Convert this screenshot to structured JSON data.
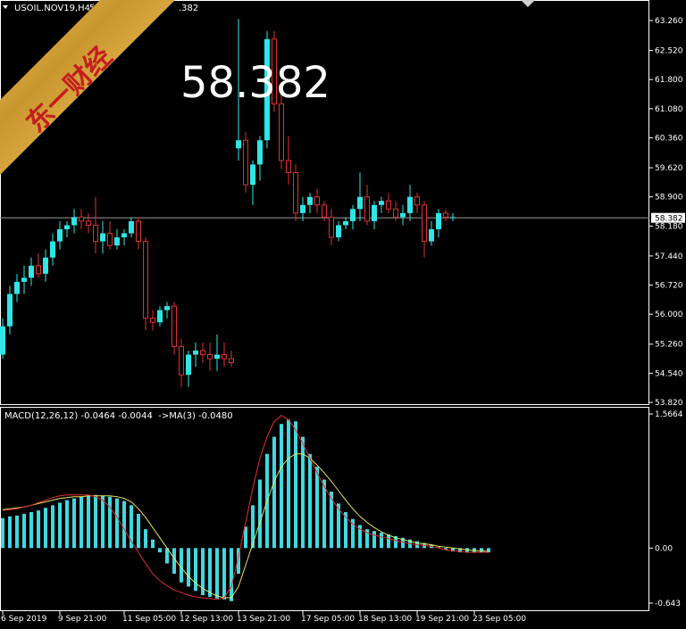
{
  "header": {
    "symbol_label": "USOIL.NOV19,H4",
    "ohlc_label": "58.37",
    "ohlc_tail": ".382"
  },
  "watermark_text": "东一财经",
  "big_price": "58.382",
  "current_price_label": "58.382",
  "colors": {
    "bull": "#2EE6E6",
    "bear": "#E03030",
    "macd_hist": "#40D8E0",
    "signal": "#E6E060",
    "macd_line": "#E03030",
    "grid_text": "#FFFFFF",
    "panel_border": "#FFFFFF"
  },
  "chart_data": [
    {
      "type": "candlestick",
      "ylim": [
        53.82,
        63.26
      ],
      "y_ticks": [
        "63.260",
        "62.520",
        "61.800",
        "61.080",
        "60.360",
        "59.620",
        "58.900",
        "58.180",
        "57.440",
        "56.720",
        "56.000",
        "55.260",
        "54.540",
        "53.820"
      ],
      "y_tick_values": [
        63.26,
        62.52,
        61.8,
        61.08,
        60.36,
        59.62,
        58.9,
        58.18,
        57.44,
        56.72,
        56.0,
        55.26,
        54.54,
        53.82
      ],
      "current_price": 58.382,
      "candles": [
        [
          55.0,
          55.9,
          54.9,
          55.7
        ],
        [
          55.7,
          56.7,
          55.5,
          56.5
        ],
        [
          56.5,
          57.0,
          56.3,
          56.8
        ],
        [
          56.8,
          57.2,
          56.5,
          56.9
        ],
        [
          56.9,
          57.4,
          56.7,
          57.2
        ],
        [
          57.2,
          57.5,
          56.9,
          57.0
        ],
        [
          57.0,
          57.6,
          56.8,
          57.4
        ],
        [
          57.4,
          58.0,
          57.2,
          57.8
        ],
        [
          57.8,
          58.3,
          57.6,
          58.1
        ],
        [
          58.1,
          58.3,
          57.9,
          58.2
        ],
        [
          58.2,
          58.6,
          58.0,
          58.4
        ],
        [
          58.4,
          58.6,
          58.1,
          58.3
        ],
        [
          58.3,
          58.5,
          58.0,
          58.2
        ],
        [
          58.2,
          58.9,
          57.5,
          57.8
        ],
        [
          57.8,
          58.3,
          57.5,
          58.0
        ],
        [
          58.0,
          58.3,
          57.6,
          57.7
        ],
        [
          57.7,
          58.1,
          57.6,
          57.9
        ],
        [
          57.9,
          58.1,
          57.7,
          58.0
        ],
        [
          58.0,
          58.4,
          57.9,
          58.3
        ],
        [
          58.3,
          58.4,
          57.6,
          57.8
        ],
        [
          57.8,
          57.9,
          55.6,
          55.9
        ],
        [
          55.9,
          56.1,
          55.6,
          55.8
        ],
        [
          55.8,
          56.2,
          55.7,
          56.1
        ],
        [
          56.1,
          56.3,
          55.9,
          56.2
        ],
        [
          56.2,
          56.3,
          55.0,
          55.2
        ],
        [
          55.2,
          55.4,
          54.2,
          54.5
        ],
        [
          54.5,
          55.1,
          54.2,
          55.0
        ],
        [
          55.0,
          55.3,
          54.7,
          55.1
        ],
        [
          55.1,
          55.3,
          54.8,
          55.0
        ],
        [
          55.0,
          55.3,
          54.6,
          54.9
        ],
        [
          54.9,
          55.5,
          54.6,
          55.0
        ],
        [
          55.0,
          55.3,
          54.7,
          54.9
        ],
        [
          54.9,
          55.1,
          54.7,
          54.8
        ],
        [
          60.1,
          63.3,
          59.8,
          60.3
        ],
        [
          60.3,
          60.5,
          59.0,
          59.2
        ],
        [
          59.2,
          59.8,
          58.7,
          59.7
        ],
        [
          59.7,
          60.4,
          59.3,
          60.3
        ],
        [
          60.3,
          63.0,
          60.1,
          62.8
        ],
        [
          62.8,
          63.0,
          61.0,
          61.2
        ],
        [
          61.2,
          61.5,
          59.6,
          59.8
        ],
        [
          59.8,
          60.4,
          59.2,
          59.5
        ],
        [
          59.5,
          59.7,
          58.3,
          58.5
        ],
        [
          58.5,
          58.9,
          58.3,
          58.7
        ],
        [
          58.7,
          59.0,
          58.5,
          58.9
        ],
        [
          58.9,
          59.1,
          58.5,
          58.7
        ],
        [
          58.7,
          58.8,
          58.3,
          58.4
        ],
        [
          58.4,
          58.6,
          57.7,
          57.9
        ],
        [
          57.9,
          58.3,
          57.8,
          58.2
        ],
        [
          58.2,
          58.4,
          58.1,
          58.3
        ],
        [
          58.3,
          58.7,
          58.1,
          58.6
        ],
        [
          58.6,
          59.5,
          58.3,
          58.9
        ],
        [
          58.9,
          59.2,
          58.2,
          58.3
        ],
        [
          58.3,
          58.8,
          58.1,
          58.7
        ],
        [
          58.7,
          58.9,
          58.5,
          58.8
        ],
        [
          58.8,
          59.0,
          58.5,
          58.6
        ],
        [
          58.6,
          58.8,
          58.3,
          58.4
        ],
        [
          58.4,
          58.7,
          58.2,
          58.5
        ],
        [
          58.5,
          59.2,
          58.3,
          58.9
        ],
        [
          58.9,
          59.0,
          58.5,
          58.7
        ],
        [
          58.7,
          58.8,
          57.4,
          57.8
        ],
        [
          57.8,
          58.3,
          57.7,
          58.1
        ],
        [
          58.1,
          58.6,
          57.9,
          58.5
        ],
        [
          58.5,
          58.6,
          58.3,
          58.4
        ],
        [
          58.4,
          58.5,
          58.3,
          58.4
        ]
      ]
    },
    {
      "type": "macd",
      "title": "MACD(12,26,12) -0.0464 -0.0044  ->MA(3) -0.0480",
      "ylim": [
        -0.643,
        1.5664
      ],
      "y_ticks": [
        "1.5664",
        "0.00",
        "-0.643"
      ],
      "y_tick_values": [
        1.5664,
        0.0,
        -0.643
      ],
      "x_ticks": [
        {
          "label": "6 Sep 2019",
          "index": 0
        },
        {
          "label": "9 Sep 21:00",
          "index": 8
        },
        {
          "label": "11 Sep 05:00",
          "index": 17
        },
        {
          "label": "12 Sep 13:00",
          "index": 25
        },
        {
          "label": "13 Sep 21:00",
          "index": 33
        },
        {
          "label": "17 Sep 05:00",
          "index": 42
        },
        {
          "label": "18 Sep 13:00",
          "index": 50
        },
        {
          "label": "19 Sep 21:00",
          "index": 58
        },
        {
          "label": "23 Sep 05:00",
          "index": 66
        }
      ],
      "histogram": [
        0.35,
        0.37,
        0.38,
        0.4,
        0.42,
        0.44,
        0.47,
        0.5,
        0.53,
        0.56,
        0.58,
        0.6,
        0.61,
        0.62,
        0.61,
        0.6,
        0.58,
        0.55,
        0.5,
        0.4,
        0.22,
        0.1,
        -0.05,
        -0.18,
        -0.3,
        -0.4,
        -0.45,
        -0.5,
        -0.55,
        -0.57,
        -0.59,
        -0.6,
        -0.62,
        -0.3,
        0.25,
        0.5,
        0.8,
        1.1,
        1.3,
        1.45,
        1.5,
        1.48,
        1.3,
        1.1,
        0.95,
        0.8,
        0.66,
        0.52,
        0.42,
        0.34,
        0.27,
        0.22,
        0.2,
        0.18,
        0.16,
        0.14,
        0.12,
        0.1,
        0.08,
        0.06,
        0.04,
        0.01,
        -0.02,
        -0.04,
        -0.05,
        -0.05,
        -0.05,
        -0.05,
        -0.05
      ],
      "signal": [
        0.45,
        0.46,
        0.47,
        0.48,
        0.5,
        0.52,
        0.54,
        0.56,
        0.58,
        0.59,
        0.6,
        0.6,
        0.61,
        0.61,
        0.61,
        0.61,
        0.6,
        0.58,
        0.54,
        0.46,
        0.36,
        0.24,
        0.12,
        0.0,
        -0.12,
        -0.23,
        -0.33,
        -0.41,
        -0.47,
        -0.52,
        -0.56,
        -0.58,
        -0.58,
        -0.45,
        -0.2,
        0.05,
        0.3,
        0.55,
        0.78,
        0.95,
        1.05,
        1.1,
        1.1,
        1.05,
        0.97,
        0.88,
        0.78,
        0.67,
        0.56,
        0.46,
        0.37,
        0.3,
        0.24,
        0.19,
        0.15,
        0.12,
        0.1,
        0.08,
        0.06,
        0.05,
        0.04,
        0.02,
        0.01,
        0.0,
        -0.01,
        -0.02,
        -0.03,
        -0.03,
        -0.04
      ],
      "macd_line": [
        0.44,
        0.45,
        0.46,
        0.48,
        0.5,
        0.53,
        0.56,
        0.59,
        0.61,
        0.62,
        0.62,
        0.62,
        0.62,
        0.6,
        0.56,
        0.48,
        0.36,
        0.22,
        0.08,
        -0.05,
        -0.18,
        -0.3,
        -0.38,
        -0.44,
        -0.49,
        -0.52,
        -0.55,
        -0.57,
        -0.58,
        -0.59,
        -0.6,
        -0.58,
        -0.45,
        -0.1,
        0.3,
        0.7,
        1.05,
        1.3,
        1.48,
        1.55,
        1.5,
        1.38,
        1.22,
        1.05,
        0.88,
        0.72,
        0.58,
        0.46,
        0.36,
        0.28,
        0.22,
        0.18,
        0.15,
        0.13,
        0.11,
        0.09,
        0.07,
        0.05,
        0.04,
        0.03,
        0.02,
        0.0,
        -0.02,
        -0.03,
        -0.04,
        -0.05,
        -0.05,
        -0.05,
        -0.05
      ]
    }
  ]
}
